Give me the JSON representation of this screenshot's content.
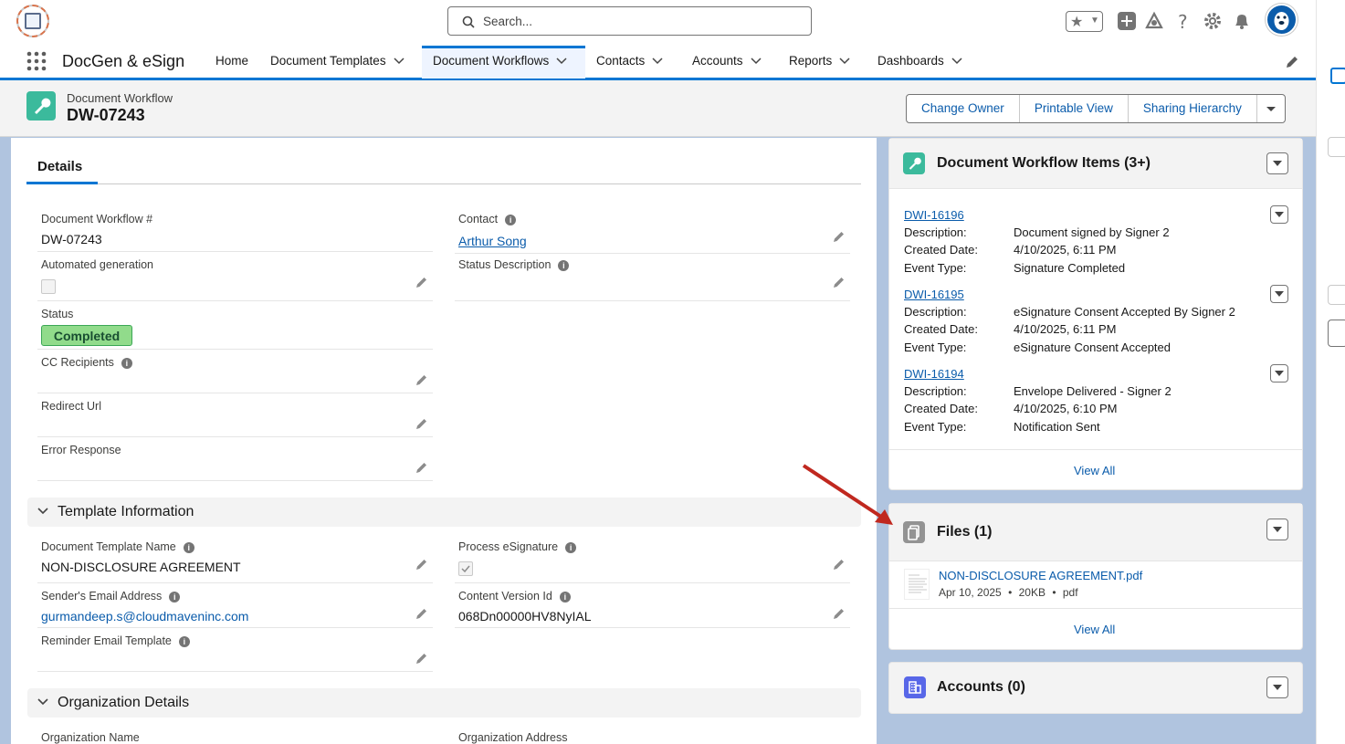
{
  "header": {
    "search_placeholder": "Search..."
  },
  "nav": {
    "app_name": "DocGen & eSign",
    "items": [
      {
        "label": "Home"
      },
      {
        "label": "Document Templates"
      },
      {
        "label": "Document Workflows"
      },
      {
        "label": "Contacts"
      },
      {
        "label": "Accounts"
      },
      {
        "label": "Reports"
      },
      {
        "label": "Dashboards"
      }
    ]
  },
  "record": {
    "type": "Document Workflow",
    "name": "DW-07243",
    "buttons": {
      "change_owner": "Change Owner",
      "printable_view": "Printable View",
      "sharing_hierarchy": "Sharing Hierarchy"
    }
  },
  "details": {
    "tab": "Details",
    "workflow_num_label": "Document Workflow #",
    "workflow_num_value": "DW-07243",
    "contact_label": "Contact",
    "contact_value": "Arthur Song",
    "automated_label": "Automated generation",
    "status_desc_label": "Status Description",
    "status_label": "Status",
    "status_value": "Completed",
    "cc_label": "CC Recipients",
    "redirect_label": "Redirect Url",
    "error_label": "Error Response"
  },
  "template_section": {
    "title": "Template Information",
    "template_name_label": "Document Template Name",
    "template_name_value": "NON-DISCLOSURE AGREEMENT",
    "process_esig_label": "Process eSignature",
    "sender_email_label": "Sender's Email Address",
    "sender_email_value": "gurmandeep.s@cloudmaveninc.com",
    "content_version_label": "Content Version Id",
    "content_version_value": "068Dn00000HV8NyIAL",
    "reminder_label": "Reminder Email Template"
  },
  "org_section": {
    "title": "Organization Details",
    "org_name_label": "Organization Name",
    "org_address_label": "Organization Address"
  },
  "workflow_items": {
    "title": "Document Workflow Items (3+)",
    "desc_label": "Description:",
    "created_label": "Created Date:",
    "event_label": "Event Type:",
    "items": [
      {
        "id": "DWI-16196",
        "description": "Document signed by Signer 2",
        "created": "4/10/2025, 6:11 PM",
        "event": "Signature Completed"
      },
      {
        "id": "DWI-16195",
        "description": "eSignature Consent Accepted By Signer 2",
        "created": "4/10/2025, 6:11 PM",
        "event": "eSignature Consent Accepted"
      },
      {
        "id": "DWI-16194",
        "description": "Envelope Delivered - Signer 2",
        "created": "4/10/2025, 6:10 PM",
        "event": "Notification Sent"
      }
    ],
    "view_all": "View All"
  },
  "files": {
    "title": "Files (1)",
    "file_name": "NON-DISCLOSURE AGREEMENT.pdf",
    "file_date": "Apr 10, 2025",
    "file_size": "20KB",
    "file_ext": "pdf",
    "view_all": "View All"
  },
  "accounts": {
    "title": "Accounts (0)"
  },
  "colors": {
    "brand": "#0176d3",
    "link": "#0b5cab",
    "status_green": "#91db8b",
    "annotation_arrow": "#c0281f"
  }
}
